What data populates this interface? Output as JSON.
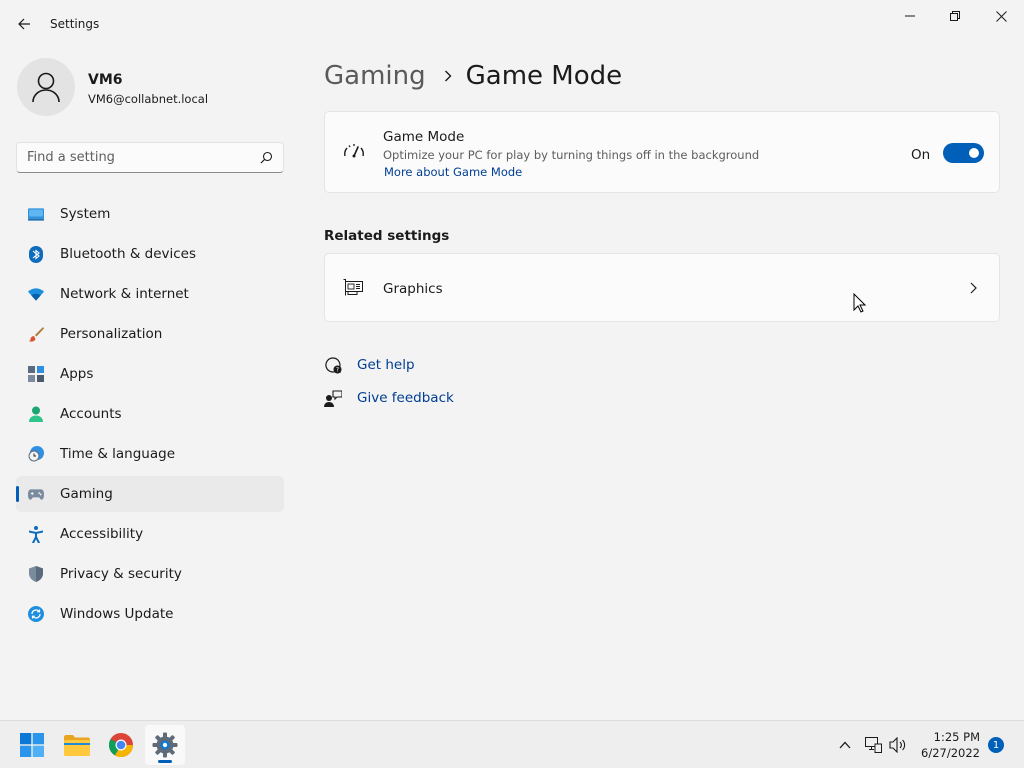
{
  "window": {
    "title": "Settings"
  },
  "user": {
    "name": "VM6",
    "email": "VM6@collabnet.local"
  },
  "search": {
    "placeholder": "Find a setting"
  },
  "sidebar": {
    "items": [
      {
        "label": "System",
        "icon": "monitor-icon"
      },
      {
        "label": "Bluetooth & devices",
        "icon": "bluetooth-icon"
      },
      {
        "label": "Network & internet",
        "icon": "wifi-icon"
      },
      {
        "label": "Personalization",
        "icon": "brush-icon"
      },
      {
        "label": "Apps",
        "icon": "apps-icon"
      },
      {
        "label": "Accounts",
        "icon": "person-icon"
      },
      {
        "label": "Time & language",
        "icon": "clock-globe-icon"
      },
      {
        "label": "Gaming",
        "icon": "gamepad-icon",
        "active": true
      },
      {
        "label": "Accessibility",
        "icon": "accessibility-icon"
      },
      {
        "label": "Privacy & security",
        "icon": "shield-icon"
      },
      {
        "label": "Windows Update",
        "icon": "update-icon"
      }
    ]
  },
  "breadcrumb": {
    "parent": "Gaming",
    "current": "Game Mode"
  },
  "game_mode": {
    "title": "Game Mode",
    "description": "Optimize your PC for play by turning things off in the background",
    "link": "More about Game Mode",
    "toggle_label": "On",
    "enabled": true
  },
  "related": {
    "title": "Related settings",
    "graphics_label": "Graphics"
  },
  "help": {
    "get_help": "Get help",
    "give_feedback": "Give feedback"
  },
  "taskbar": {
    "time": "1:25 PM",
    "date": "6/27/2022",
    "notification_count": "1"
  },
  "colors": {
    "accent": "#005fb8",
    "link": "#003e92",
    "background": "#f3f3f3",
    "card": "#fbfbfb"
  }
}
